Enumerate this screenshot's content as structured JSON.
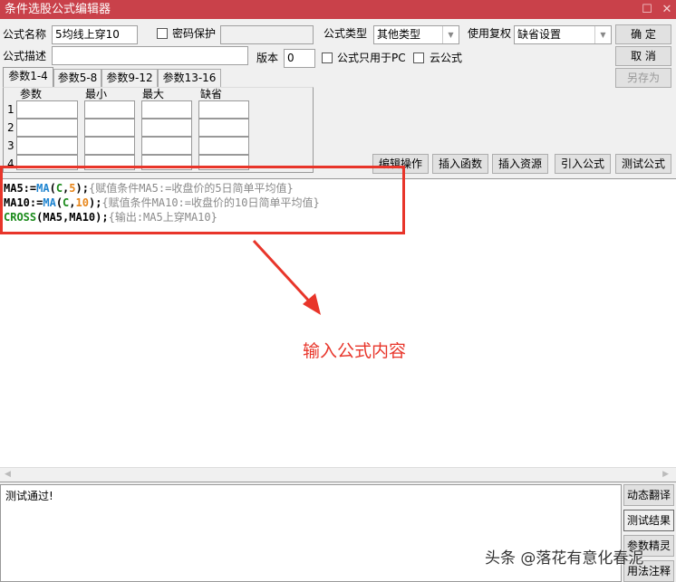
{
  "window": {
    "title": "条件选股公式编辑器"
  },
  "form": {
    "name_label": "公式名称",
    "name_value": "5均线上穿10",
    "password_label": "密码保护",
    "type_label": "公式类型",
    "type_value": "其他类型",
    "adjust_label": "使用复权",
    "adjust_value": "缺省设置",
    "desc_label": "公式描述",
    "desc_value": "",
    "version_label": "版本",
    "version_value": "0",
    "pc_only_label": "公式只用于PC",
    "cloud_label": "云公式"
  },
  "buttons": {
    "ok": "确 定",
    "cancel": "取 消",
    "save_as": "另存为"
  },
  "tabs": [
    "参数1-4",
    "参数5-8",
    "参数9-12",
    "参数13-16"
  ],
  "params": {
    "headers": [
      "参数",
      "最小",
      "最大",
      "缺省"
    ],
    "rows": [
      "1",
      "2",
      "3",
      "4"
    ]
  },
  "toolbar": [
    "编辑操作",
    "插入函数",
    "插入资源",
    "引入公式",
    "测试公式"
  ],
  "code": {
    "l1": {
      "a": "MA5:=",
      "b": "MA",
      "c": "(",
      "d": "C",
      ",": ",",
      "e": "5",
      "f": ");",
      "g": "{赋值条件MA5:=收盘价的5日简单平均值}"
    },
    "l2": {
      "a": "MA10:=",
      "b": "MA",
      "c": "(",
      "d": "C",
      ",": ",",
      "e": "10",
      "f": ");",
      "g": "{赋值条件MA10:=收盘价的10日简单平均值}"
    },
    "l3": {
      "a": "CROSS",
      "b": "(MA5,MA10);",
      "g": "{输出:MA5上穿MA10}"
    }
  },
  "annotation": {
    "text": "输入公式内容",
    "color": "#e8352a"
  },
  "output": {
    "text": "测试通过!"
  },
  "side_buttons": [
    "动态翻译",
    "测试结果",
    "参数精灵",
    "用法注释"
  ],
  "watermark": "头条 @落花有意化春泥"
}
